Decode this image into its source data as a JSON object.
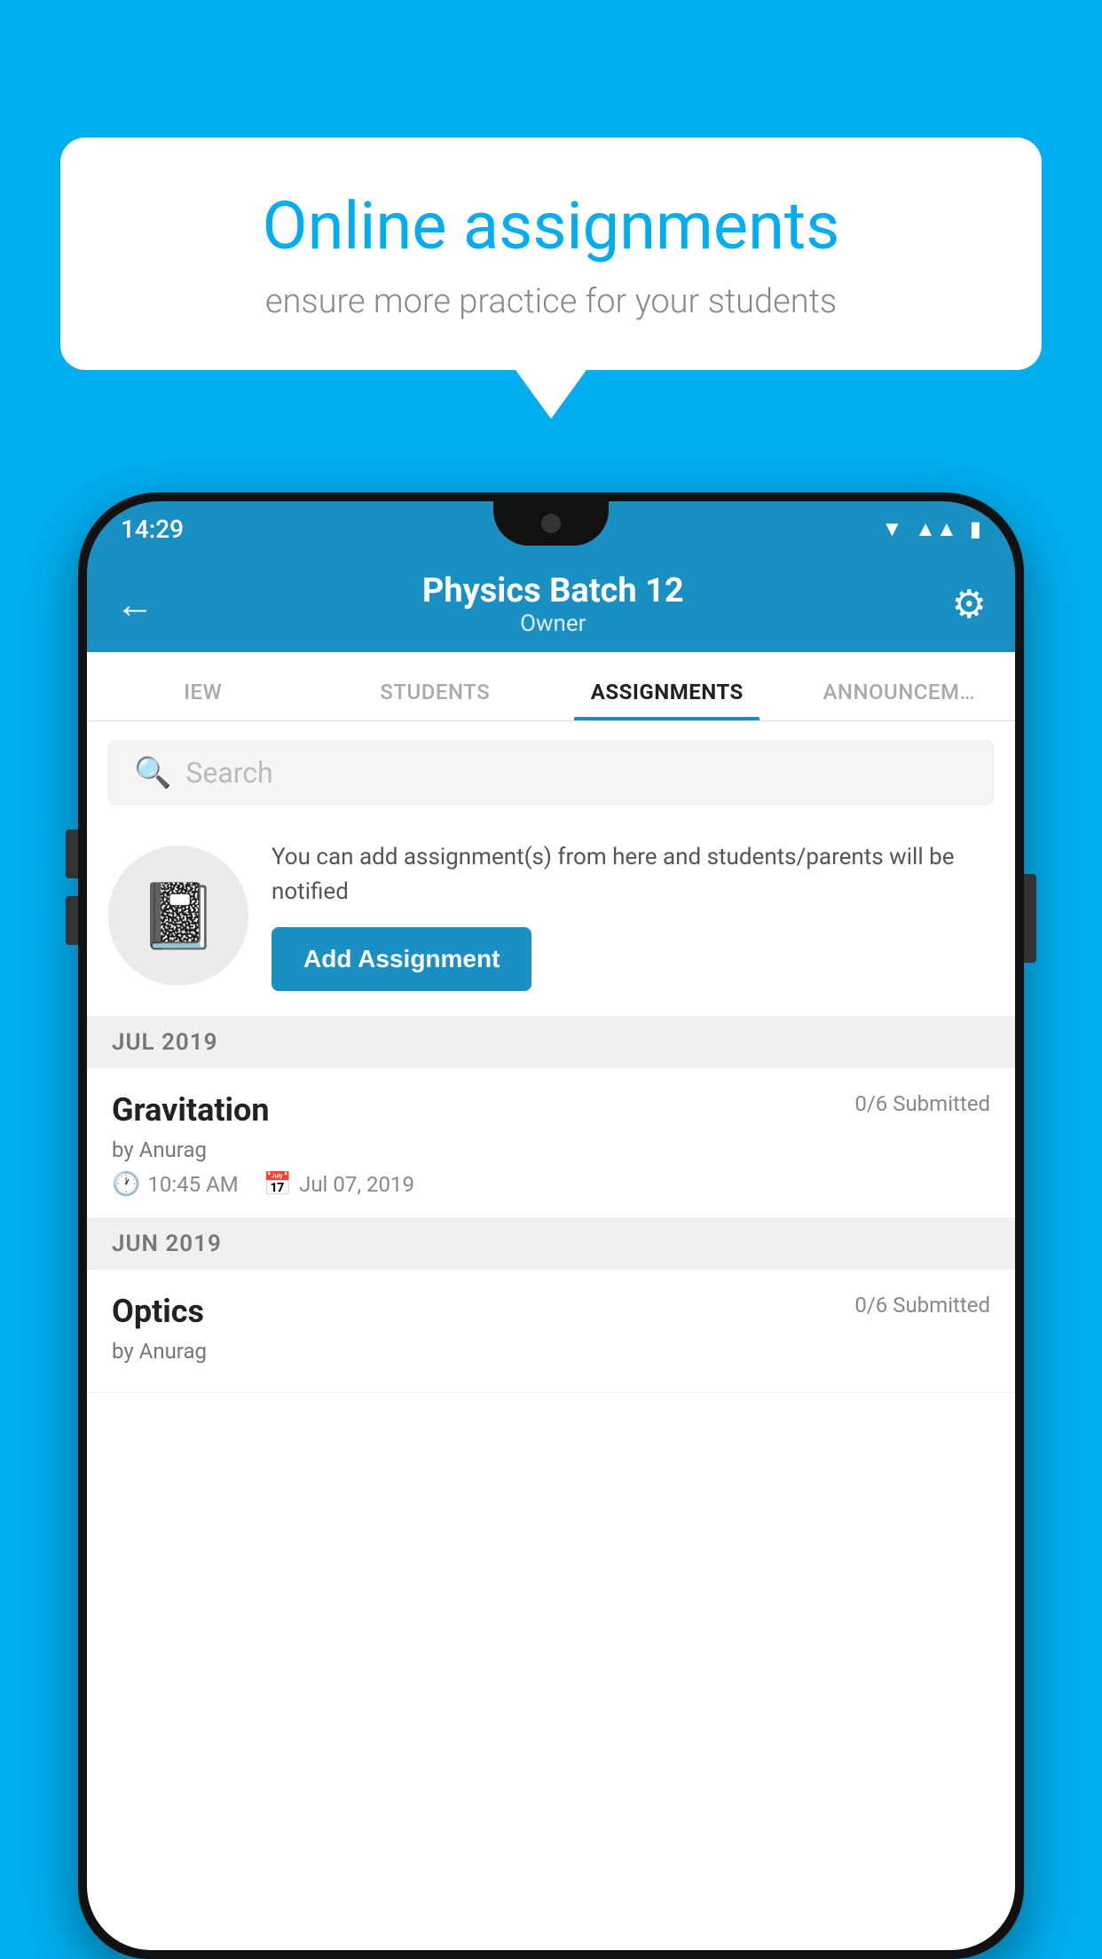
{
  "background": {
    "color": "#00AEEF"
  },
  "speech_bubble": {
    "title": "Online assignments",
    "subtitle": "ensure more practice for your students"
  },
  "status_bar": {
    "time": "14:29",
    "wifi_icon": "▾",
    "signal_icon": "▲",
    "battery_icon": "▮"
  },
  "app_header": {
    "back_label": "←",
    "title": "Physics Batch 12",
    "subtitle": "Owner",
    "settings_icon": "⚙"
  },
  "tabs": [
    {
      "label": "IEW",
      "active": false
    },
    {
      "label": "STUDENTS",
      "active": false
    },
    {
      "label": "ASSIGNMENTS",
      "active": true
    },
    {
      "label": "ANNOUNCEM…",
      "active": false
    }
  ],
  "search": {
    "placeholder": "Search"
  },
  "promo": {
    "text": "You can add assignment(s) from here and students/parents will be notified",
    "button_label": "Add Assignment"
  },
  "assignment_groups": [
    {
      "month_label": "JUL 2019",
      "assignments": [
        {
          "title": "Gravitation",
          "submitted": "0/6 Submitted",
          "by": "by Anurag",
          "time": "10:45 AM",
          "date": "Jul 07, 2019"
        }
      ]
    },
    {
      "month_label": "JUN 2019",
      "assignments": [
        {
          "title": "Optics",
          "submitted": "0/6 Submitted",
          "by": "by Anurag",
          "time": "",
          "date": ""
        }
      ]
    }
  ]
}
